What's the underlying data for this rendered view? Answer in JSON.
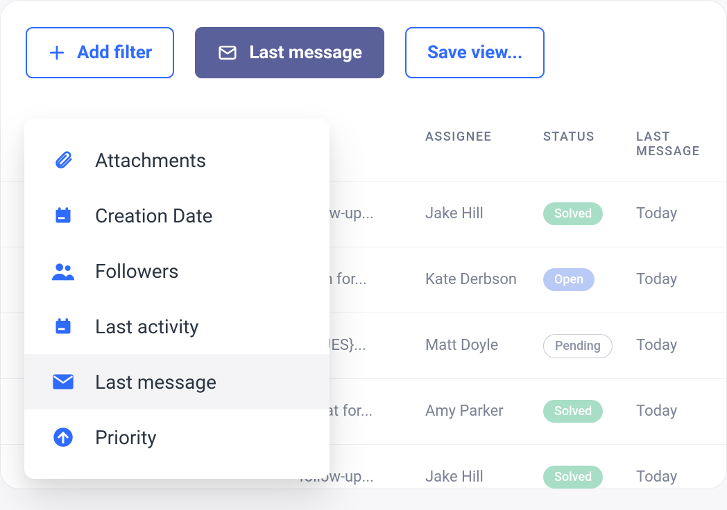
{
  "toolbar": {
    "add_filter_label": "Add filter",
    "last_message_label": "Last message",
    "save_view_label": "Save view..."
  },
  "columns": {
    "assignee": "ASSIGNEE",
    "status": "STATUS",
    "last_message": "LAST MESSAGE"
  },
  "dropdown": {
    "items": [
      {
        "label": "Attachments",
        "icon": "paperclip-icon"
      },
      {
        "label": "Creation Date",
        "icon": "calendar-icon"
      },
      {
        "label": "Followers",
        "icon": "followers-icon"
      },
      {
        "label": "Last activity",
        "icon": "calendar-icon"
      },
      {
        "label": "Last message",
        "icon": "mail-icon",
        "selected": true
      },
      {
        "label": "Priority",
        "icon": "arrow-up-circle-icon"
      }
    ]
  },
  "rows": [
    {
      "subject": "follow-up...",
      "assignee": "Jake Hill",
      "status": "Solved",
      "status_class": "solved",
      "last_message": "Today"
    },
    {
      "subject": "stion for...",
      "assignee": "Kate Derbson",
      "status": "Open",
      "status_class": "open",
      "last_message": "Today"
    },
    {
      "subject": "ISSUES}...",
      "assignee": "Matt Doyle",
      "status": "Pending",
      "status_class": "pending",
      "last_message": "Today"
    },
    {
      "subject": "- Chat for...",
      "assignee": "Amy Parker",
      "status": "Solved",
      "status_class": "solved",
      "last_message": "Today"
    },
    {
      "subject": "follow-up...",
      "assignee": "Jake Hill",
      "status": "Solved",
      "status_class": "solved",
      "last_message": "Today"
    }
  ]
}
